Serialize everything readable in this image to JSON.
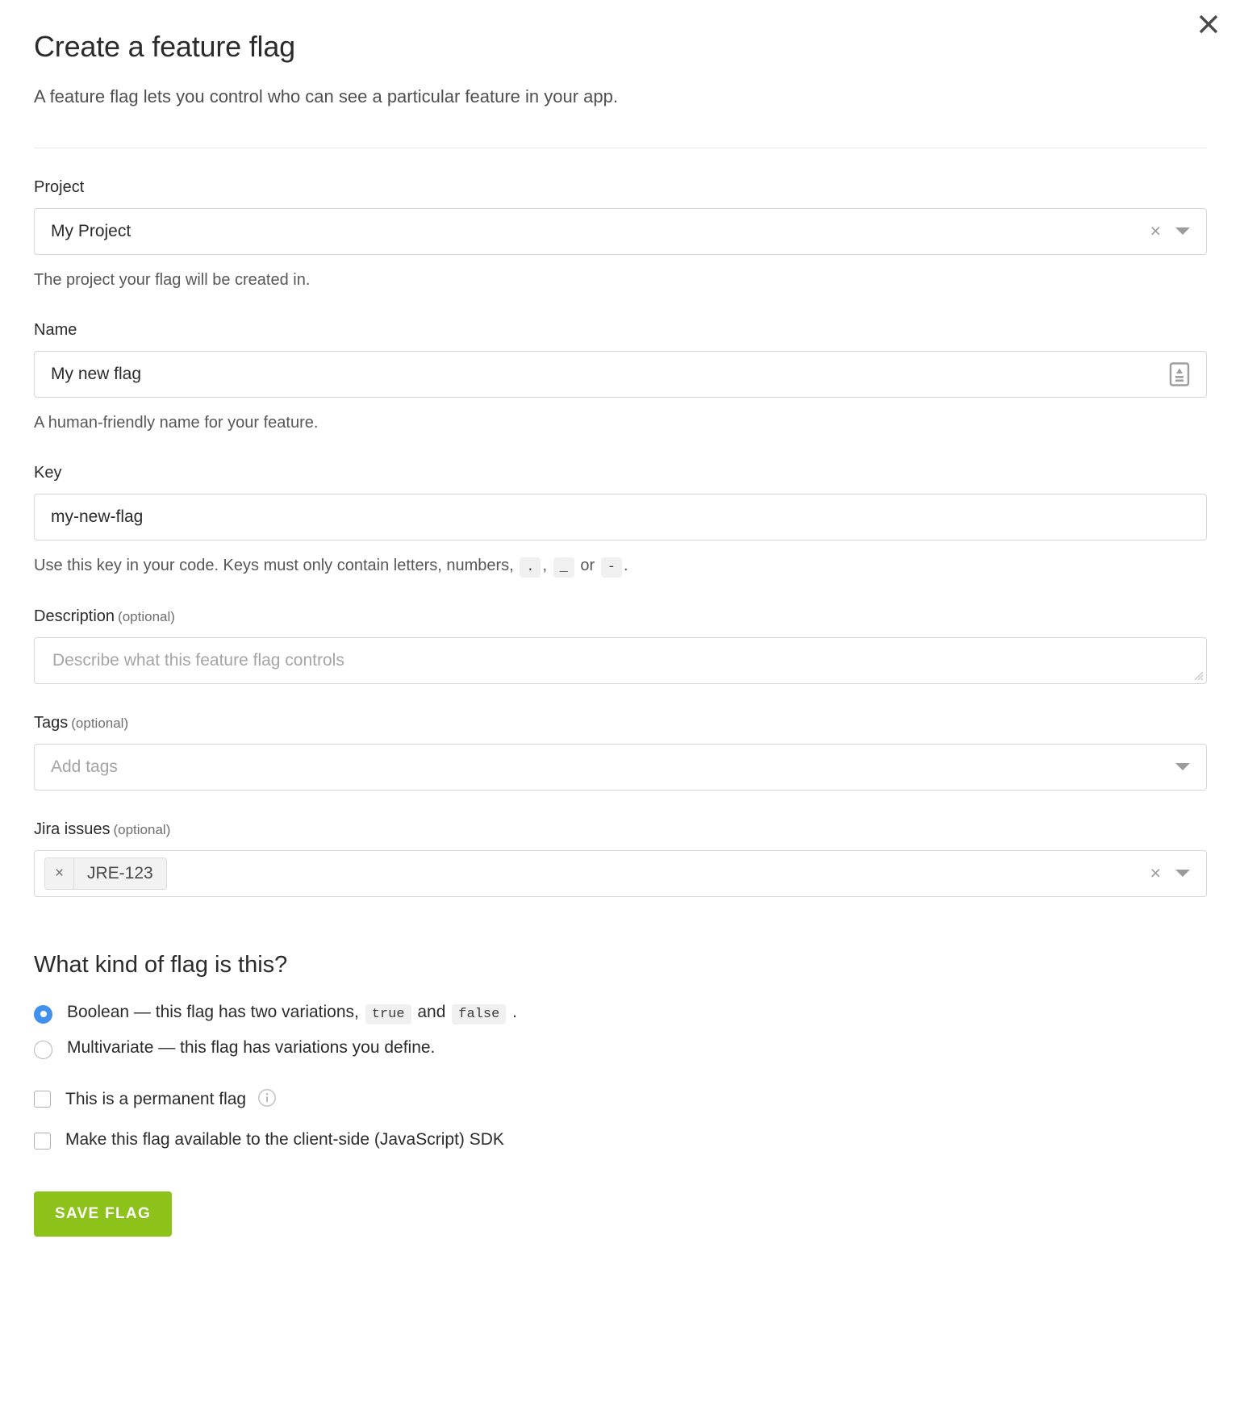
{
  "header": {
    "title": "Create a feature flag",
    "subtitle": "A feature flag lets you control who can see a particular feature in your app.",
    "close_label": "×"
  },
  "fields": {
    "project": {
      "label": "Project",
      "value": "My Project",
      "help": "The project your flag will be created in.",
      "clear_label": "×"
    },
    "name": {
      "label": "Name",
      "value": "My new flag",
      "help": "A human-friendly name for your feature."
    },
    "key": {
      "label": "Key",
      "value": "my-new-flag",
      "help_prefix": "Use this key in your code. Keys must only contain letters, numbers,",
      "chip_dot": ".",
      "help_comma": ",",
      "chip_underscore": "_",
      "help_or": "or",
      "chip_dash": "-",
      "help_suffix": "."
    },
    "description": {
      "label": "Description",
      "optional": "(optional)",
      "placeholder": "Describe what this feature flag controls",
      "value": ""
    },
    "tags": {
      "label": "Tags",
      "optional": "(optional)",
      "placeholder": "Add tags",
      "value": ""
    },
    "jira": {
      "label": "Jira issues",
      "optional": "(optional)",
      "token": "JRE-123",
      "token_remove_label": "×",
      "clear_label": "×"
    }
  },
  "flag_kind": {
    "heading": "What kind of flag is this?",
    "boolean": {
      "text_before": "Boolean — this flag has two variations,",
      "chip_true": "true",
      "text_and": "and",
      "chip_false": "false",
      "text_after": ".",
      "selected": true
    },
    "multivariate": {
      "label": "Multivariate — this flag has variations you define.",
      "selected": false
    }
  },
  "checkboxes": [
    {
      "label": "This is a permanent flag",
      "checked": false,
      "has_info": true
    },
    {
      "label": "Make this flag available to the client-side (JavaScript) SDK",
      "checked": false,
      "has_info": false
    }
  ],
  "actions": {
    "save_label": "SAVE FLAG"
  },
  "colors": {
    "accent_green": "#8cc21a",
    "radio_blue": "#4290ee",
    "border": "#d6d6d6",
    "text": "#2b2b2b",
    "muted": "#6e6e6e"
  }
}
